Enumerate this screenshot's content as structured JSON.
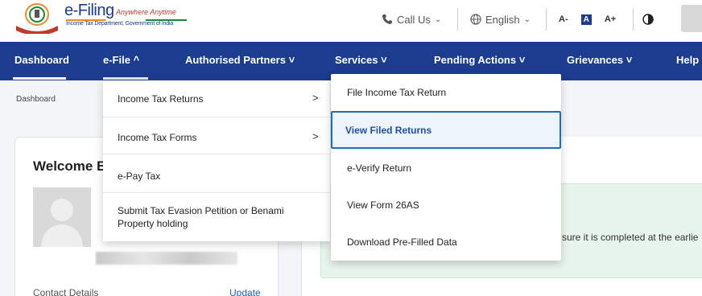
{
  "header": {
    "logo_title": "e-Filing",
    "logo_tagline": "Anywhere Anytime",
    "logo_subtitle": "Income Tax Department, Government of India",
    "call_us": "Call Us",
    "language": "English",
    "font_decrease": "A-",
    "font_normal": "A",
    "font_increase": "A+",
    "icons": {
      "phone": "phone-icon",
      "globe": "globe-icon",
      "contrast": "contrast-icon",
      "chevron": "chevron-down-icon"
    }
  },
  "navbar": {
    "items": [
      {
        "label": "Dashboard"
      },
      {
        "label": "e-File ^"
      },
      {
        "label": "Authorised Partners ˅"
      },
      {
        "label": "Services ˅"
      },
      {
        "label": "Pending Actions ˅"
      },
      {
        "label": "Grievances ˅"
      },
      {
        "label": "Help"
      }
    ]
  },
  "breadcrumb": "Dashboard",
  "welcome": {
    "title": "Welcome E",
    "contact_label": "Contact Details",
    "update_label": "Update"
  },
  "banner": {
    "text": "sure it is completed at the earlie"
  },
  "efile_menu": {
    "items": [
      {
        "label": "Income Tax Returns",
        "has_submenu": true
      },
      {
        "label": "Income Tax Forms",
        "has_submenu": true
      },
      {
        "label": "e-Pay Tax",
        "has_submenu": false
      },
      {
        "label": "Submit Tax Evasion Petition or Benami Property holding",
        "has_submenu": false
      }
    ],
    "arrow": ">"
  },
  "returns_submenu": {
    "items": [
      {
        "label": "File Income Tax Return"
      },
      {
        "label": "View Filed Returns"
      },
      {
        "label": "e-Verify Return"
      },
      {
        "label": "View Form 26AS"
      },
      {
        "label": "Download Pre-Filled Data"
      }
    ],
    "selected_index": 1
  },
  "colors": {
    "navbar_bg": "#1b3c8f",
    "selected_border": "#1b6fc0",
    "banner_bg": "#e8f5ec"
  }
}
